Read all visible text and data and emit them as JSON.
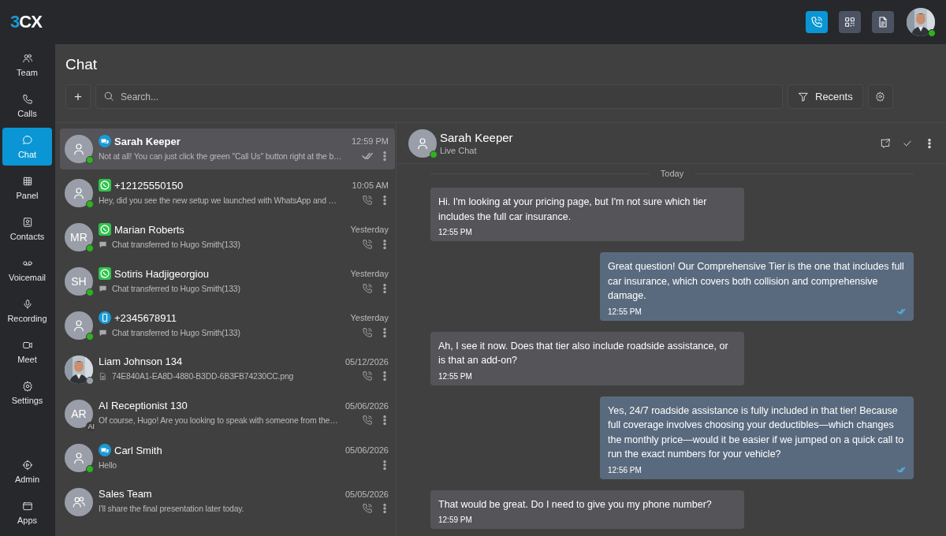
{
  "brand": {
    "digit": "3",
    "letters": "CX"
  },
  "top_actions": [
    {
      "selected": true
    },
    {
      "selected": false
    },
    {
      "selected": false
    }
  ],
  "user": {
    "online": true
  },
  "nav": [
    {
      "label": "Team",
      "selected": false
    },
    {
      "label": "Calls",
      "selected": false
    },
    {
      "label": "Chat",
      "selected": true
    },
    {
      "label": "Panel",
      "selected": false
    },
    {
      "label": "Contacts",
      "selected": false
    },
    {
      "label": "Voicemail",
      "selected": false
    },
    {
      "label": "Recording",
      "selected": false
    },
    {
      "label": "Meet",
      "selected": false
    },
    {
      "label": "Settings",
      "selected": false
    }
  ],
  "nav_bottom": [
    {
      "label": "Admin",
      "selected": false
    },
    {
      "label": "Apps",
      "selected": false
    }
  ],
  "page_title": "Chat",
  "toolbar": {
    "add": "+",
    "search_placeholder": "Search...",
    "filter": "Recents"
  },
  "conversations": [
    {
      "kind": "person",
      "name": "Sarah Keeper",
      "time": "12:59 PM",
      "preview": "Not at all! You can just click the green \"Call Us\" button right at the b…",
      "channel": {
        "kind": "livechat"
      },
      "color": "#2db31f",
      "transferred": false,
      "attachment": false,
      "read": true,
      "call": false,
      "selected": true,
      "bold": true
    },
    {
      "kind": "person",
      "name": "+12125550150",
      "time": "10:05 AM",
      "preview": "Hey, did you see the new setup we launched with WhatsApp and …",
      "channel": {
        "kind": "whatsapp"
      },
      "color": "#2db31f",
      "transferred": false,
      "attachment": false,
      "read": false,
      "call": true,
      "selected": false,
      "bold": false
    },
    {
      "kind": "initials",
      "initials": "MR",
      "name": "Marian Roberts",
      "time": "Yesterday",
      "preview": "Chat transferred to Hugo Smith(133)",
      "channel": {
        "kind": "whatsapp"
      },
      "color": "#2db31f",
      "transferred": true,
      "attachment": false,
      "read": false,
      "call": true,
      "selected": false,
      "bold": false
    },
    {
      "kind": "initials",
      "initials": "SH",
      "name": "Sotiris Hadjigeorgiou",
      "time": "Yesterday",
      "preview": "Chat transferred to Hugo Smith(133)",
      "channel": {
        "kind": "whatsapp"
      },
      "color": "#2db31f",
      "transferred": true,
      "attachment": false,
      "read": false,
      "call": true,
      "selected": false,
      "bold": false
    },
    {
      "kind": "person",
      "name": "+2345678911",
      "time": "Yesterday",
      "preview": "Chat transferred to Hugo Smith(133)",
      "channel": {
        "kind": "sms"
      },
      "color": "#2db31f",
      "transferred": true,
      "attachment": false,
      "read": false,
      "call": true,
      "selected": false,
      "bold": false
    },
    {
      "name": "Liam Johnson 134",
      "time": "05/12/2026",
      "preview": "74E840A1-EA8D-4880-B3DD-6B3FB74230CC.png",
      "color": "#9aa0aa",
      "transferred": false,
      "attachment": true,
      "read": false,
      "call": true,
      "selected": false,
      "bold": false
    },
    {
      "kind": "initials",
      "initials": "AR",
      "badge": "AI",
      "name": "AI Receptionist 130",
      "time": "05/06/2026",
      "preview": "Of course, Hugo! Are you looking to speak with someone from the…",
      "transferred": false,
      "attachment": false,
      "read": false,
      "call": true,
      "selected": false,
      "bold": false
    },
    {
      "kind": "person",
      "name": "Carl Smith",
      "time": "05/06/2026",
      "preview": "Hello",
      "channel": {
        "kind": "livechat"
      },
      "color": "#2db31f",
      "transferred": false,
      "attachment": false,
      "read": false,
      "call": false,
      "selected": false,
      "bold": false
    },
    {
      "kind": "group",
      "name": "Sales Team",
      "time": "05/05/2026",
      "preview": "I'll share the final presentation later today.",
      "transferred": false,
      "attachment": false,
      "read": false,
      "call": true,
      "selected": false,
      "bold": false
    }
  ],
  "chat": {
    "name": "Sarah Keeper",
    "subtitle": "Live Chat",
    "online": true,
    "day": "Today",
    "messages": [
      {
        "kind": "incoming",
        "text": "Hi. I'm looking at your pricing page, but I'm not sure which tier includes the full car insurance.",
        "time": "12:55 PM",
        "read": false
      },
      {
        "kind": "outgoing",
        "text": "Great question! Our Comprehensive Tier is the one that includes full car insurance, which covers both collision and comprehensive damage.",
        "time": "12:55 PM",
        "read": true
      },
      {
        "kind": "incoming",
        "text": "Ah, I see it now. Does that tier also include roadside assistance, or is that an add-on?",
        "time": "12:55 PM",
        "read": false
      },
      {
        "kind": "outgoing",
        "text": "Yes, 24/7 roadside assistance is fully included in that tier! Because full coverage involves choosing your deductibles—which changes the monthly price—would it be easier if we jumped on a quick call to run the exact numbers for your vehicle?",
        "time": "12:56 PM",
        "read": true
      },
      {
        "kind": "incoming",
        "text": "That would be great. Do I need to give you my phone number?",
        "time": "12:59 PM",
        "read": false
      }
    ]
  }
}
